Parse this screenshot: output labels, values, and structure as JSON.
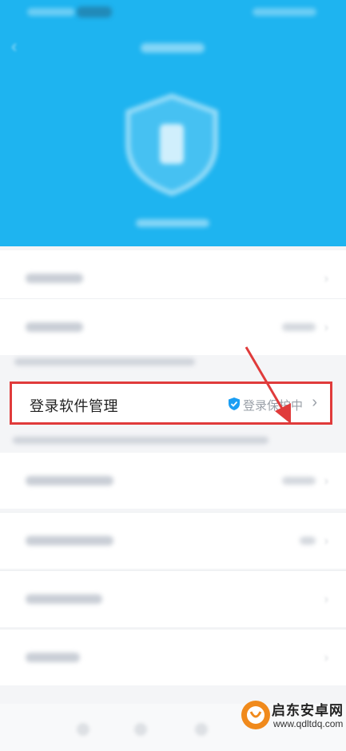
{
  "highlighted_row": {
    "label": "登录软件管理",
    "status": "登录保护中",
    "chevron": "›"
  },
  "colors": {
    "header_blue": "#1eb4f0",
    "highlight_border": "#e03b3b",
    "shield_badge": "#1b9ef3"
  },
  "icons": {
    "back": "back-arrow-icon",
    "shield_large": "shield-icon",
    "shield_small": "verified-shield-icon",
    "chevron": "chevron-right-icon"
  },
  "watermark": {
    "name": "启东安卓网",
    "url": "www.qdltdq.com"
  }
}
